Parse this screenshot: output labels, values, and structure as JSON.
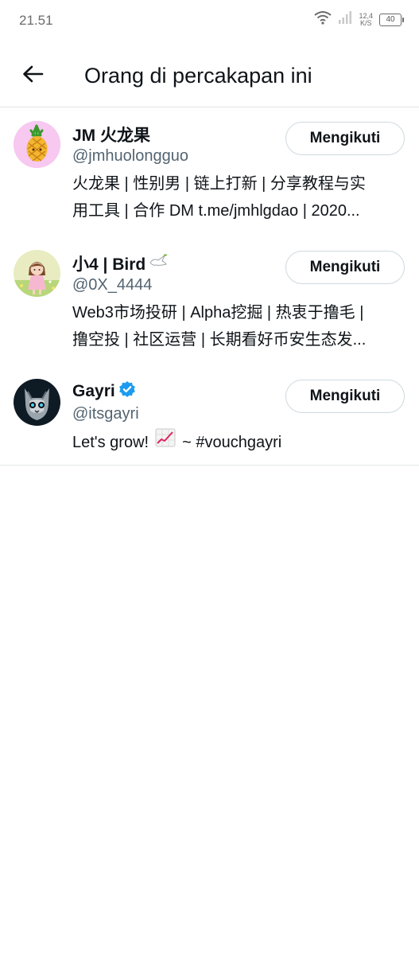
{
  "status_bar": {
    "time": "21.51",
    "speed_value": "12,4",
    "speed_unit": "K/S",
    "battery": "40"
  },
  "header": {
    "back_icon": "arrow-left-icon",
    "title": "Orang di percakapan ini"
  },
  "users": [
    {
      "name": "JM 火龙果",
      "handle": "@jmhuolongguo",
      "bio_line1": "火龙果 | 性别男 | 链上打新 | 分享教程与实",
      "bio_line2": "用工具 | 合作 DM t.me/jmhlgdao | 2020...",
      "follow_label": "Mengikuti",
      "avatar": "pineapple-avatar"
    },
    {
      "name": "小4 | Bird",
      "name_emoji": "dove-icon",
      "handle": "@0X_4444",
      "bio_line1": "Web3市场投研 | Alpha挖掘 | 热衷于撸毛 |",
      "bio_line2": "撸空投 | 社区运营 | 长期看好币安生态发...",
      "follow_label": "Mengikuti",
      "avatar": "girl-avatar"
    },
    {
      "name": "Gayri",
      "verified": "verified-badge-icon",
      "handle": "@itsgayri",
      "bio_text": "Let's grow!",
      "bio_emoji": "chart-increasing-icon",
      "bio_suffix": "~ #vouchgayri",
      "follow_label": "Mengikuti",
      "avatar": "robot-cat-avatar"
    }
  ],
  "colors": {
    "text": "#0f1419",
    "secondary": "#536471",
    "divider": "#e1e4e6",
    "verified": "#1d9bf0"
  }
}
